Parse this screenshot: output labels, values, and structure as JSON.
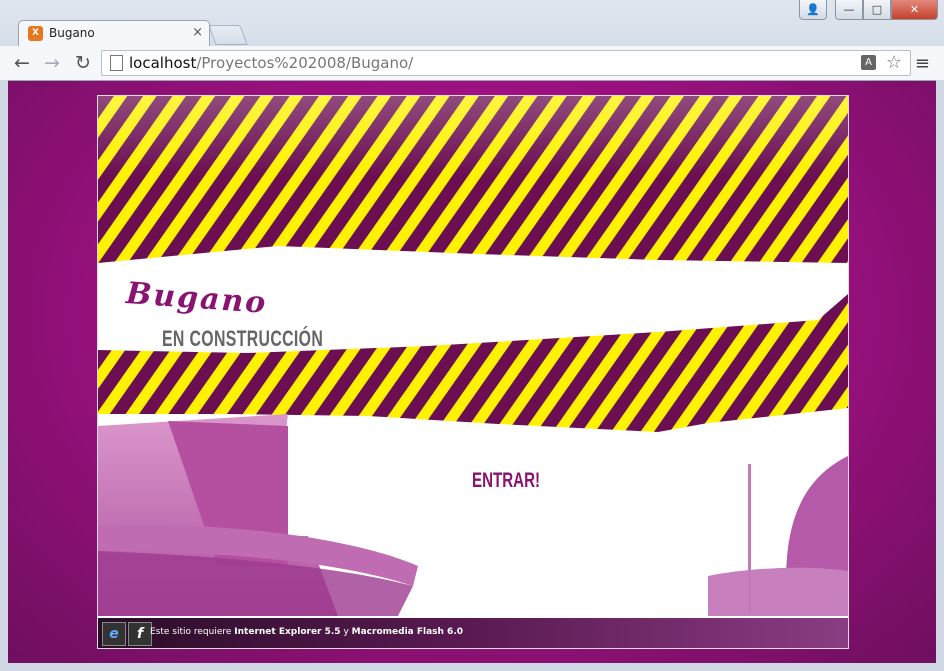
{
  "browser": {
    "tab_title": "Bugano",
    "tab_close": "×",
    "url_host": "localhost",
    "url_path": "/Proyectos%202008/Bugano/",
    "favicon_glyph": "X"
  },
  "page": {
    "brand": "Bugano",
    "subtitle": "EN CONSTRUCCIÓN",
    "enter_link": "ENTRAR!",
    "footer_prefix": "Este sitio requiere",
    "footer_req1": "Internet Explorer 5.5",
    "footer_and": "y",
    "footer_req2": "Macromedia Flash 6.0",
    "ie_icon_glyph": "e",
    "flash_icon_glyph": "f"
  },
  "colors": {
    "background": "#a8128a",
    "stripe_yellow": "#fff200",
    "stripe_purple": "#6b0f52",
    "accent": "#8a1270"
  }
}
